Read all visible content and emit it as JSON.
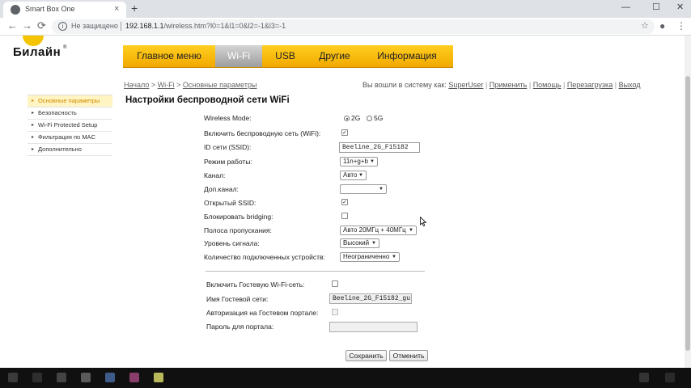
{
  "browser": {
    "tab_title": "Smart Box One",
    "tab_close": "×",
    "new_tab": "+",
    "window_controls": [
      "—",
      "☐",
      "✕"
    ],
    "nav_back": "←",
    "nav_forward": "→",
    "nav_reload": "⟳",
    "security_label": "Не защищено",
    "url_host": "192.168.1.1",
    "url_path": "/wireless.htm?l0=1&l1=0&l2=-1&l3=-1",
    "star": "☆",
    "menu": "⋮"
  },
  "logo": {
    "text": "Билайн",
    "tm": "®"
  },
  "main_nav": [
    "Главное меню",
    "Wi-Fi",
    "USB",
    "Другие",
    "Информация"
  ],
  "breadcrumb": {
    "home": "Начало",
    "sep": " > ",
    "wifi": "Wi-Fi",
    "current": "Основные параметры"
  },
  "userbar": {
    "prefix": "Вы вошли в систему как:",
    "user": "SuperUser",
    "apply": "Применить",
    "help": "Помощь",
    "reboot": "Перезагрузка",
    "logout": "Выход",
    "sep": "|"
  },
  "page_title": "Настройки беспроводной сети WiFi",
  "sidebar": [
    {
      "label": "Основные параметры",
      "active": true
    },
    {
      "label": "Безопасность"
    },
    {
      "label": "Wi-Fi Protected Setup"
    },
    {
      "label": "Фильтрация по MAC"
    },
    {
      "label": "Дополнительно"
    }
  ],
  "form": {
    "wireless_mode_label": "Wireless Mode:",
    "mode_2g": "2G",
    "mode_5g": "5G",
    "enable_wifi_label": "Включить беспроводную сеть (WiFi):",
    "ssid_label": "ID сети (SSID):",
    "ssid_value": "Beeline_2G_F15182",
    "mode_label": "Режим работы:",
    "mode_value": "11n+g+b",
    "channel_label": "Канал:",
    "channel_value": "Авто",
    "ext_channel_label": "Доп.канал:",
    "ext_channel_value": "",
    "open_ssid_label": "Открытый SSID:",
    "block_bridging_label": "Блокировать bridging:",
    "bandwidth_label": "Полоса пропускания:",
    "bandwidth_value": "Авто 20МГц + 40МГц",
    "signal_label": "Уровень сигнала:",
    "signal_value": "Высокий",
    "devices_label": "Количество подключенных устройств:",
    "devices_value": "Неограниченно",
    "guest_enable_label": "Включить Гостевую Wi-Fi-сеть:",
    "guest_name_label": "Имя Гостевой сети:",
    "guest_name_value": "Beeline_2G_F15182_gu",
    "guest_portal_label": "Авторизация на Гостевом портале:",
    "portal_password_label": "Пароль для портала:",
    "portal_password_value": "",
    "check_mark": "✓",
    "dropdown_arrow": "▼"
  },
  "buttons": {
    "save": "Сохранить",
    "cancel": "Отменить"
  },
  "colors": {
    "nav_yellow": "#f5b400",
    "nav_active": "#a8a8a8",
    "sidebar_active": "#fff4c2",
    "sidebar_active_text": "#d08a00"
  }
}
